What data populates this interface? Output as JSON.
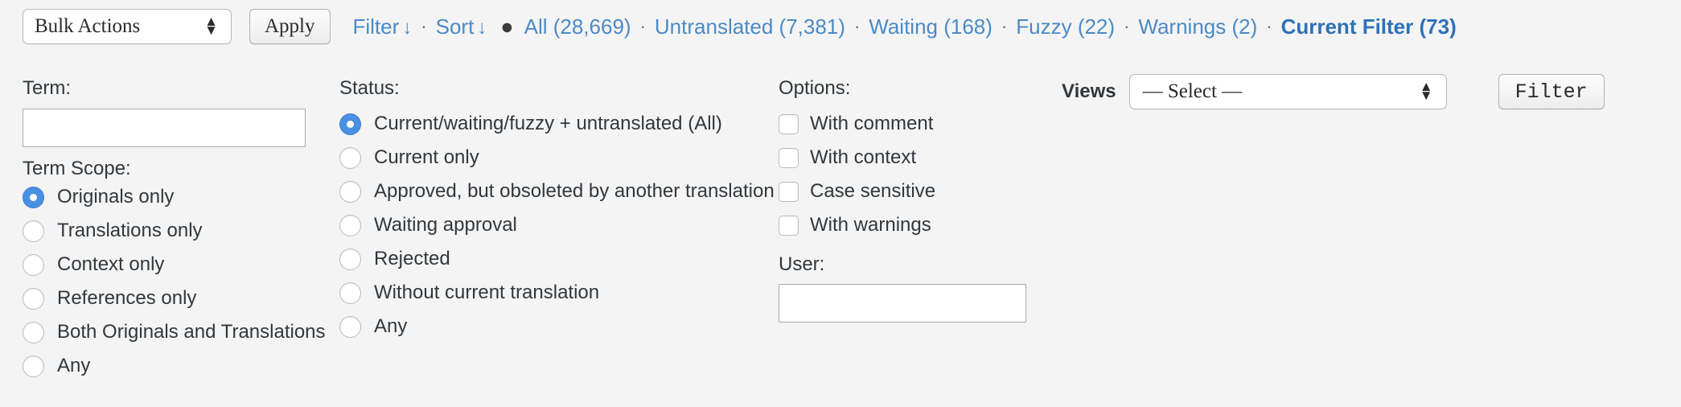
{
  "toolbar": {
    "bulk_select_value": "Bulk Actions",
    "apply_label": "Apply",
    "filter_sort": {
      "filter_label": "Filter",
      "filter_arrow": "↓",
      "sort_label": "Sort",
      "sort_arrow": "↓",
      "separator": "·",
      "bullet": "●"
    },
    "filter_links": [
      {
        "label": "All (28,669)",
        "current": false
      },
      {
        "label": "Untranslated (7,381)",
        "current": false
      },
      {
        "label": "Waiting (168)",
        "current": false
      },
      {
        "label": "Fuzzy (22)",
        "current": false
      },
      {
        "label": "Warnings (2)",
        "current": false
      },
      {
        "label": "Current Filter (73)",
        "current": true
      }
    ]
  },
  "term": {
    "label": "Term:",
    "value": "",
    "placeholder": "",
    "scope_label": "Term Scope:",
    "scope_options": [
      {
        "label": "Originals only",
        "selected": true
      },
      {
        "label": "Translations only",
        "selected": false
      },
      {
        "label": "Context only",
        "selected": false
      },
      {
        "label": "References only",
        "selected": false
      },
      {
        "label": "Both Originals and Translations",
        "selected": false
      },
      {
        "label": "Any",
        "selected": false
      }
    ]
  },
  "status": {
    "label": "Status:",
    "options": [
      {
        "label": "Current/waiting/fuzzy + untranslated (All)",
        "selected": true
      },
      {
        "label": "Current only",
        "selected": false
      },
      {
        "label": "Approved, but obsoleted by another translation",
        "selected": false
      },
      {
        "label": "Waiting approval",
        "selected": false
      },
      {
        "label": "Rejected",
        "selected": false
      },
      {
        "label": "Without current translation",
        "selected": false
      },
      {
        "label": "Any",
        "selected": false
      }
    ]
  },
  "options": {
    "label": "Options:",
    "checkboxes": [
      {
        "label": "With comment",
        "checked": false
      },
      {
        "label": "With context",
        "checked": false
      },
      {
        "label": "Case sensitive",
        "checked": false
      },
      {
        "label": "With warnings",
        "checked": false
      }
    ],
    "user_label": "User:",
    "user_value": "",
    "user_placeholder": ""
  },
  "views": {
    "label": "Views",
    "selected": "— Select —",
    "filter_button_label": "Filter"
  },
  "colors": {
    "page_bg": "#f4f4f4",
    "link": "#4b8ac6",
    "link_current": "#2e72b8",
    "radio_on": "#4a90e2",
    "text": "#32373c"
  }
}
